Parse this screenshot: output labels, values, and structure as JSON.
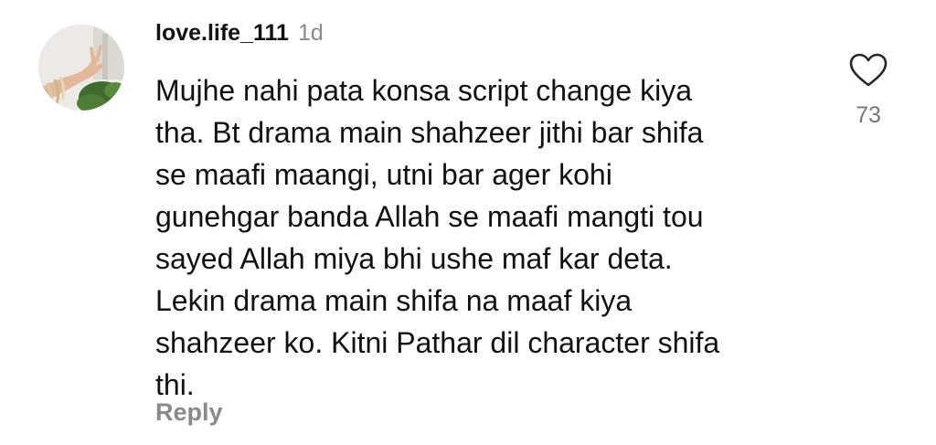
{
  "comment": {
    "username": "love.life_111",
    "time": "1d",
    "text_lines": [
      "Mujhe nahi pata konsa script change kiya",
      "tha. Bt drama main shahzeer jithi bar shifa",
      "se maafi maangi, utni bar ager kohi",
      "gunehgar banda Allah se maafi mangti tou",
      "sayed Allah miya bhi ushe maf kar deta.",
      "Lekin drama main shifa na maaf kiya",
      "shahzeer ko. Kitni Pathar dil character shifa",
      "thi."
    ],
    "reply_label": "Reply",
    "like_count": "73",
    "like_icon": "heart-outline-icon",
    "avatar_icon": "profile-photo-hand-bracelets"
  },
  "colors": {
    "text": "#111111",
    "muted": "#8a8a8a",
    "like_count": "#777777",
    "background": "#ffffff"
  }
}
